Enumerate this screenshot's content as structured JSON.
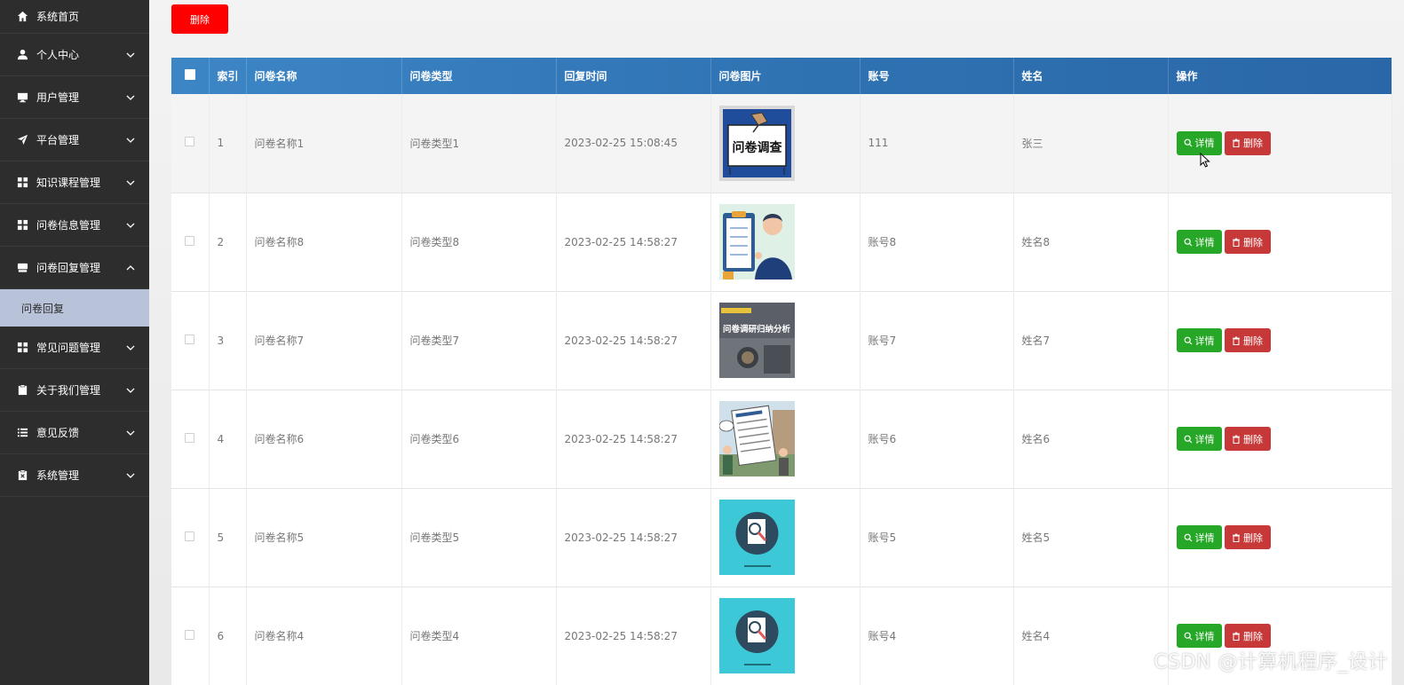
{
  "sidebar": {
    "items": [
      {
        "label": "系统首页",
        "icon": "home-icon",
        "expandable": false
      },
      {
        "label": "个人中心",
        "icon": "user-icon",
        "expandable": true
      },
      {
        "label": "用户管理",
        "icon": "monitor-icon",
        "expandable": true
      },
      {
        "label": "平台管理",
        "icon": "send-icon",
        "expandable": true
      },
      {
        "label": "知识课程管理",
        "icon": "grid-icon",
        "expandable": true
      },
      {
        "label": "问卷信息管理",
        "icon": "grid-icon",
        "expandable": true
      },
      {
        "label": "问卷回复管理",
        "icon": "tray-icon",
        "expandable": true,
        "expanded": true
      },
      {
        "label": "常见问题管理",
        "icon": "grid-icon",
        "expandable": true
      },
      {
        "label": "关于我们管理",
        "icon": "clipboard-icon",
        "expandable": true
      },
      {
        "label": "意见反馈",
        "icon": "list-icon",
        "expandable": true
      },
      {
        "label": "系统管理",
        "icon": "clipboard-x-icon",
        "expandable": true
      }
    ],
    "submenu": {
      "label": "问卷回复"
    }
  },
  "toolbar": {
    "delete_label": "删除"
  },
  "table": {
    "headers": [
      "索引",
      "问卷名称",
      "问卷类型",
      "回复时间",
      "问卷图片",
      "账号",
      "姓名",
      "操作"
    ],
    "rows": [
      {
        "index": "1",
        "name": "问卷名称1",
        "type": "问卷类型1",
        "time": "2023-02-25 15:08:45",
        "account": "111",
        "person": "张三",
        "image": "survey-sign-image",
        "image_text": "问卷调查"
      },
      {
        "index": "2",
        "name": "问卷名称8",
        "type": "问卷类型8",
        "time": "2023-02-25 14:58:27",
        "account": "账号8",
        "person": "姓名8",
        "image": "man-clipboard-image"
      },
      {
        "index": "3",
        "name": "问卷名称7",
        "type": "问卷类型7",
        "time": "2023-02-25 14:58:27",
        "account": "账号7",
        "person": "姓名7",
        "image": "survey-analysis-image",
        "image_text": "问卷调研归纳分析"
      },
      {
        "index": "4",
        "name": "问卷名称6",
        "type": "问卷类型6",
        "time": "2023-02-25 14:58:27",
        "account": "账号6",
        "person": "姓名6",
        "image": "people-questionnaire-image"
      },
      {
        "index": "5",
        "name": "问卷名称5",
        "type": "问卷类型5",
        "time": "2023-02-25 14:58:27",
        "account": "账号5",
        "person": "姓名5",
        "image": "magnifier-document-image"
      },
      {
        "index": "6",
        "name": "问卷名称4",
        "type": "问卷类型4",
        "time": "2023-02-25 14:58:27",
        "account": "账号4",
        "person": "姓名4",
        "image": "magnifier-document-image"
      }
    ],
    "actions": {
      "detail_label": "详情",
      "delete_label": "删除"
    }
  },
  "watermark": "CSDN @计算机程序_设计",
  "colors": {
    "sidebar_bg": "#2d2d2d",
    "submenu_active": "#b8c2d8",
    "header_blue": "#2f73b3",
    "detail_green": "#27a727",
    "delete_red": "#c73939",
    "top_delete_red": "#ff0000"
  }
}
